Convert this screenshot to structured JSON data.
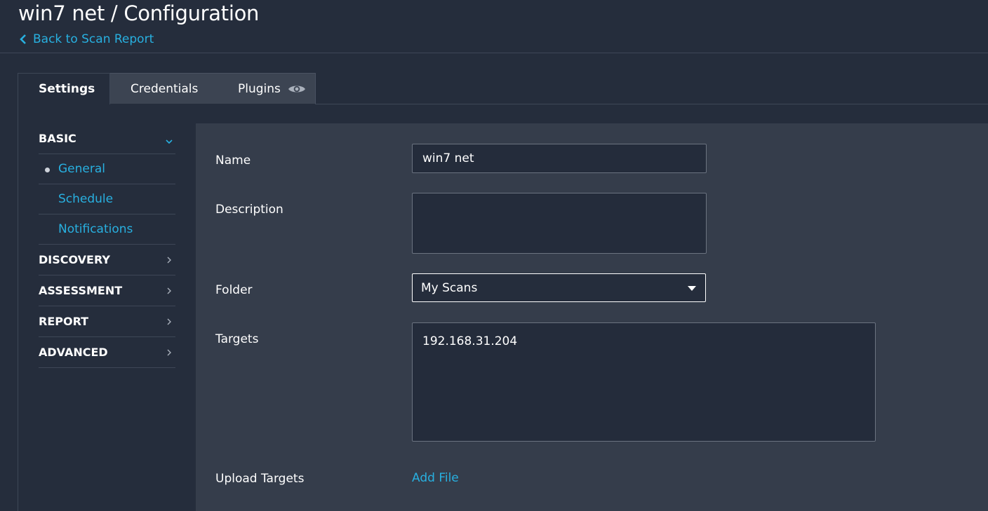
{
  "header": {
    "title": "win7 net / Configuration",
    "back_label": "Back to Scan Report"
  },
  "tabs": [
    {
      "label": "Settings",
      "active": true
    },
    {
      "label": "Credentials",
      "active": false
    },
    {
      "label": "Plugins",
      "active": false,
      "icon": "eye-icon"
    }
  ],
  "sidebar": {
    "sections": [
      {
        "label": "BASIC",
        "expanded": true,
        "items": [
          {
            "label": "General",
            "selected": true
          },
          {
            "label": "Schedule",
            "selected": false
          },
          {
            "label": "Notifications",
            "selected": false
          }
        ]
      },
      {
        "label": "DISCOVERY",
        "expanded": false
      },
      {
        "label": "ASSESSMENT",
        "expanded": false
      },
      {
        "label": "REPORT",
        "expanded": false
      },
      {
        "label": "ADVANCED",
        "expanded": false
      }
    ]
  },
  "form": {
    "name_label": "Name",
    "name_value": "win7 net",
    "description_label": "Description",
    "description_value": "",
    "folder_label": "Folder",
    "folder_value": "My Scans",
    "targets_label": "Targets",
    "targets_value": "192.168.31.204",
    "upload_label": "Upload Targets",
    "add_file_label": "Add File"
  },
  "colors": {
    "background": "#252d3c",
    "content_bg": "#353d4b",
    "accent": "#28b0e0",
    "input_bg": "#242c3b"
  }
}
